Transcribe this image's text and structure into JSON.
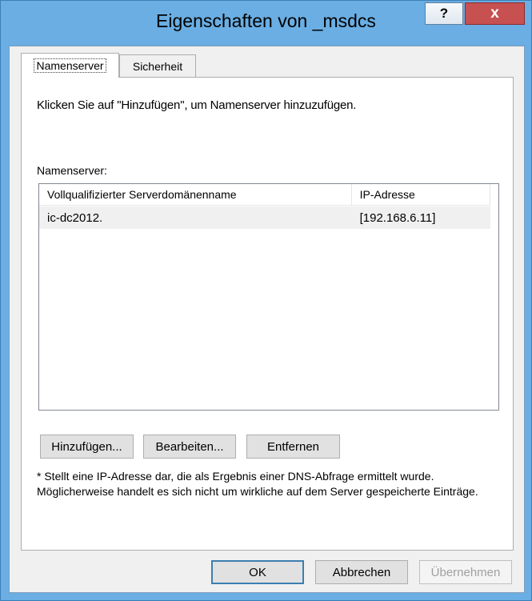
{
  "window": {
    "title": "Eigenschaften von _msdcs",
    "help_label": "?",
    "close_label": "x"
  },
  "tabs": [
    {
      "label": "Namenserver",
      "active": true
    },
    {
      "label": "Sicherheit",
      "active": false
    }
  ],
  "panel": {
    "instruction": "Klicken Sie auf \"Hinzufügen\", um Namenserver hinzuzufügen.",
    "list_label": "Namenserver:",
    "columns": [
      "Vollqualifizierter Serverdomänenname",
      "IP-Adresse"
    ],
    "rows": [
      {
        "name": "ic-dc2012.",
        "ip": "[192.168.6.11]"
      }
    ],
    "buttons": {
      "add": "Hinzufügen...",
      "edit": "Bearbeiten...",
      "remove": "Entfernen"
    },
    "note": "* Stellt eine IP-Adresse dar, die als Ergebnis einer DNS-Abfrage ermittelt wurde. Möglicherweise handelt es sich nicht um wirkliche auf dem Server gespeicherte Einträge."
  },
  "dialog_buttons": {
    "ok": "OK",
    "cancel": "Abbrechen",
    "apply": "Übernehmen"
  },
  "colors": {
    "frame": "#6aaee3",
    "close_button": "#c75050",
    "default_button_border": "#3c7fb1"
  }
}
